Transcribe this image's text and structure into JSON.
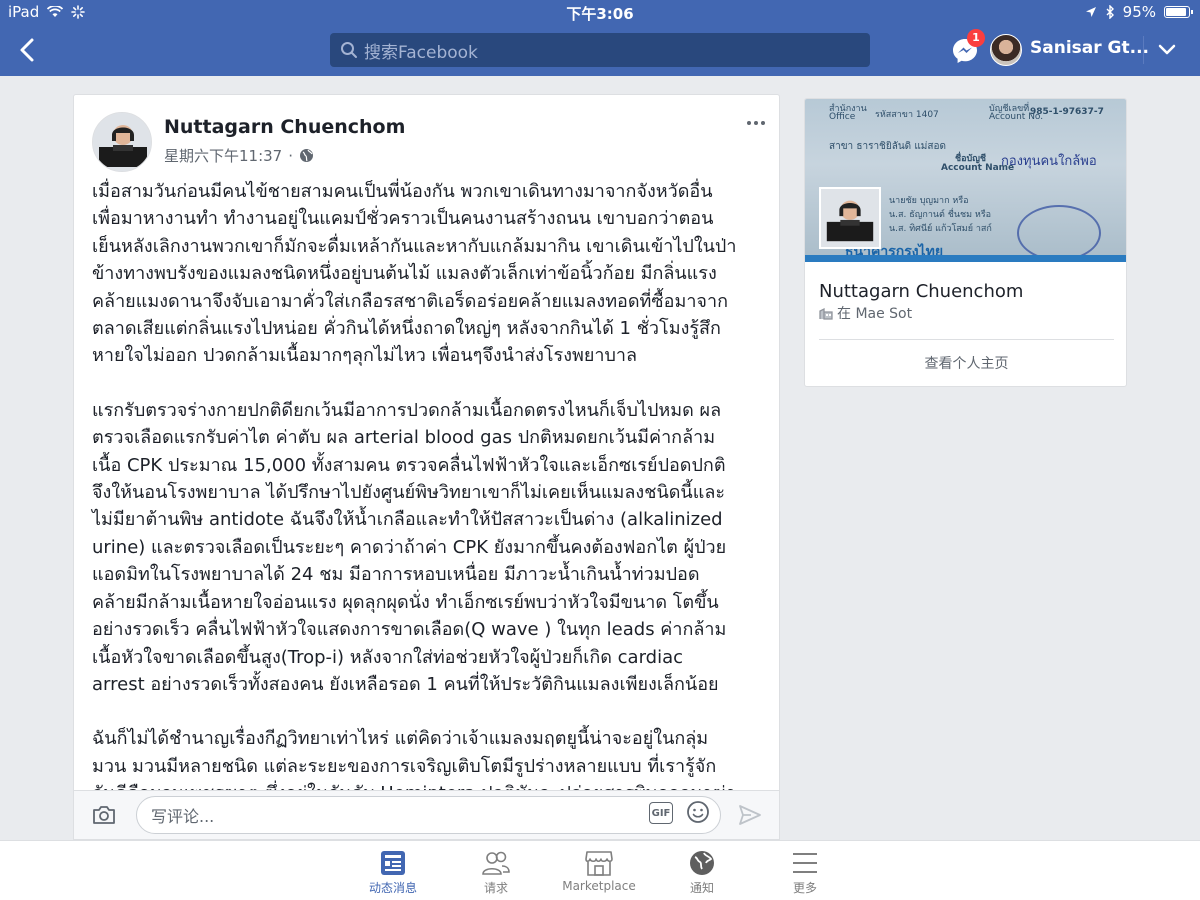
{
  "status_bar": {
    "device": "iPad",
    "time": "下午3:06",
    "battery": "95%",
    "battery_level": 0.95
  },
  "nav": {
    "search_placeholder": "搜索Facebook",
    "messenger_badge": "1",
    "user_name": "Sanisar Gt..."
  },
  "post": {
    "author": "Nuttagarn Chuenchom",
    "timestamp": "星期六下午11:37",
    "separator": "·",
    "paragraphs": [
      "เมื่อสามวันก่อนมีคนไข้ชายสามคนเป็นพี่น้องกัน พวกเขาเดินทางมาจากจังหวัดอื่น\nเพื่อมาหางานทำ ทำงานอยู่ในแคมป์ชั่วคราวเป็นคนงานสร้างถนน เขาบอกว่าตอน\nเย็นหลังเลิกงานพวกเขาก็มักจะดื่มเหล้ากันและหากับแกล้มมากิน เขาเดินเข้าไปในป่า\nข้างทางพบรังของแมลงชนิดหนึ่งอยู่บนต้นไม้ แมลงตัวเล็กเท่าข้อนิ้วก้อย มีกลิ่นแรง\nคล้ายแมงดานาจึงจับเอามาคั่วใส่เกลือรสชาติเอร็ดอร่อยคล้ายแมลงทอดที่ซื้อมาจาก\nตลาดเสียแต่กลิ่นแรงไปหน่อย คั่วกินได้หนึ่งถาดใหญ่ๆ หลังจากกินได้ 1 ชั่วโมงรู้สึก\nหายใจไม่ออก ปวดกล้ามเนื้อมากๆลุกไม่ไหว เพื่อนๆจึงนำส่งโรงพยาบาล",
      "แรกรับตรวจร่างกายปกติดียกเว้นมีอาการปวดกล้ามเนื้อกดตรงไหนก็เจ็บไปหมด ผล\nตรวจเลือดแรกรับค่าไต ค่าตับ ผล arterial blood gas ปกติหมดยกเว้นมีค่ากล้าม\nเนื้อ CPK ประมาณ  15,000 ทั้งสามคน ตรวจคลื่นไฟฟ้าหัวใจและเอ็กซเรย์ปอดปกติ\nจึงให้นอนโรงพยาบาล ได้ปรึกษาไปยังศูนย์พิษวิทยาเขาก็ไม่เคยเห็นแมลงชนิดนี้และ\nไม่มียาต้านพิษ antidote ฉันจึงให้น้ำเกลือและทำให้ปัสสาวะเป็นด่าง (alkalinized\nurine) และตรวจเลือดเป็นระยะๆ คาดว่าถ้าค่า CPK ยังมากขึ้นคงต้องฟอกไต ผู้ป่วย\nแอดมิทในโรงพยาบาลได้ 24 ชม มีอาการหอบเหนื่อย มีภาวะน้ำเกินน้ำท่วมปอด\nคล้ายมีกล้ามเนื้อหายใจอ่อนแรง ผุดลุกผุดนั่ง ทำเอ็กซเรย์พบว่าหัวใจมีขนาด โตขึ้น\nอย่างรวดเร็ว คลื่นไฟฟ้าหัวใจแสดงการขาดเลือด(Q wave ) ในทุก leads ค่ากล้าม\nเนื้อหัวใจขาดเลือดขึ้นสูง(Trop-i) หลังจากใส่ท่อช่วยหัวใจผู้ป่วยก็เกิด cardiac\narrest อย่างรวดเร็วทั้งสองคน ยังเหลือรอด 1 คนที่ให้ประวัติกินแมลงเพียงเล็กน้อย",
      "ฉันก็ไม่ได้ชำนาญเรื่องกีฏวิทยาเท่าไหร่ แต่คิดว่าเจ้าแมลงมฤตยูนี้น่าจะอยู่ในกลุ่ม\nมวน มวนมีหลายชนิด แต่ละระยะของการเจริญเติบโตมีรูปร่างหลายแบบ   ที่เรารู้จัก\nกันดีคือมวนเพชรฆาต ซึ่งอยู่ในอันดับ Hemiptera ปกติมันจะปล่อยสารพิษออกมาฆ่า"
    ]
  },
  "comment_bar": {
    "placeholder": "写评论...",
    "gif_label": "GIF"
  },
  "profile_card": {
    "name": "Nuttagarn Chuenchom",
    "location": "在 Mae Sot",
    "link": "查看个人主页",
    "cover_texts": {
      "office": "สำนักงาน",
      "office_en": "Office",
      "branch": "รหัสสาขา 1407",
      "account_no_th": "บัญชีเลขที่",
      "account_no_en": "Account No.",
      "account_no": "985-1-97637-7",
      "branch_name": "สาขา ธาราชิยิลันดิ  แม่สอด",
      "account_name_th": "ชื่อบัญชี",
      "account_name_en": "Account Name",
      "account_name": "กองทุนคนใกล้พอ",
      "holder_1": "นายชัย  บุญมาก  หรือ",
      "holder_2": "น.ส. ธัญกานต์  ชื่นชม  หรือ",
      "holder_3": "น.ส. ทิศนีย์  แก้วโสมย์ าสก์",
      "bank": "ธนาคารกรุงไทย"
    }
  },
  "tabbar": {
    "tabs": [
      {
        "label": "动态消息",
        "icon": "news-feed-icon"
      },
      {
        "label": "请求",
        "icon": "friend-requests-icon"
      },
      {
        "label": "Marketplace",
        "icon": "marketplace-icon"
      },
      {
        "label": "通知",
        "icon": "notifications-globe-icon"
      },
      {
        "label": "更多",
        "icon": "more-menu-icon"
      }
    ]
  },
  "colors": {
    "brand_blue": "#4267b2",
    "search_bg": "#29487d",
    "badge_red": "#fa3e3e",
    "page_bg": "#e9ebee"
  }
}
